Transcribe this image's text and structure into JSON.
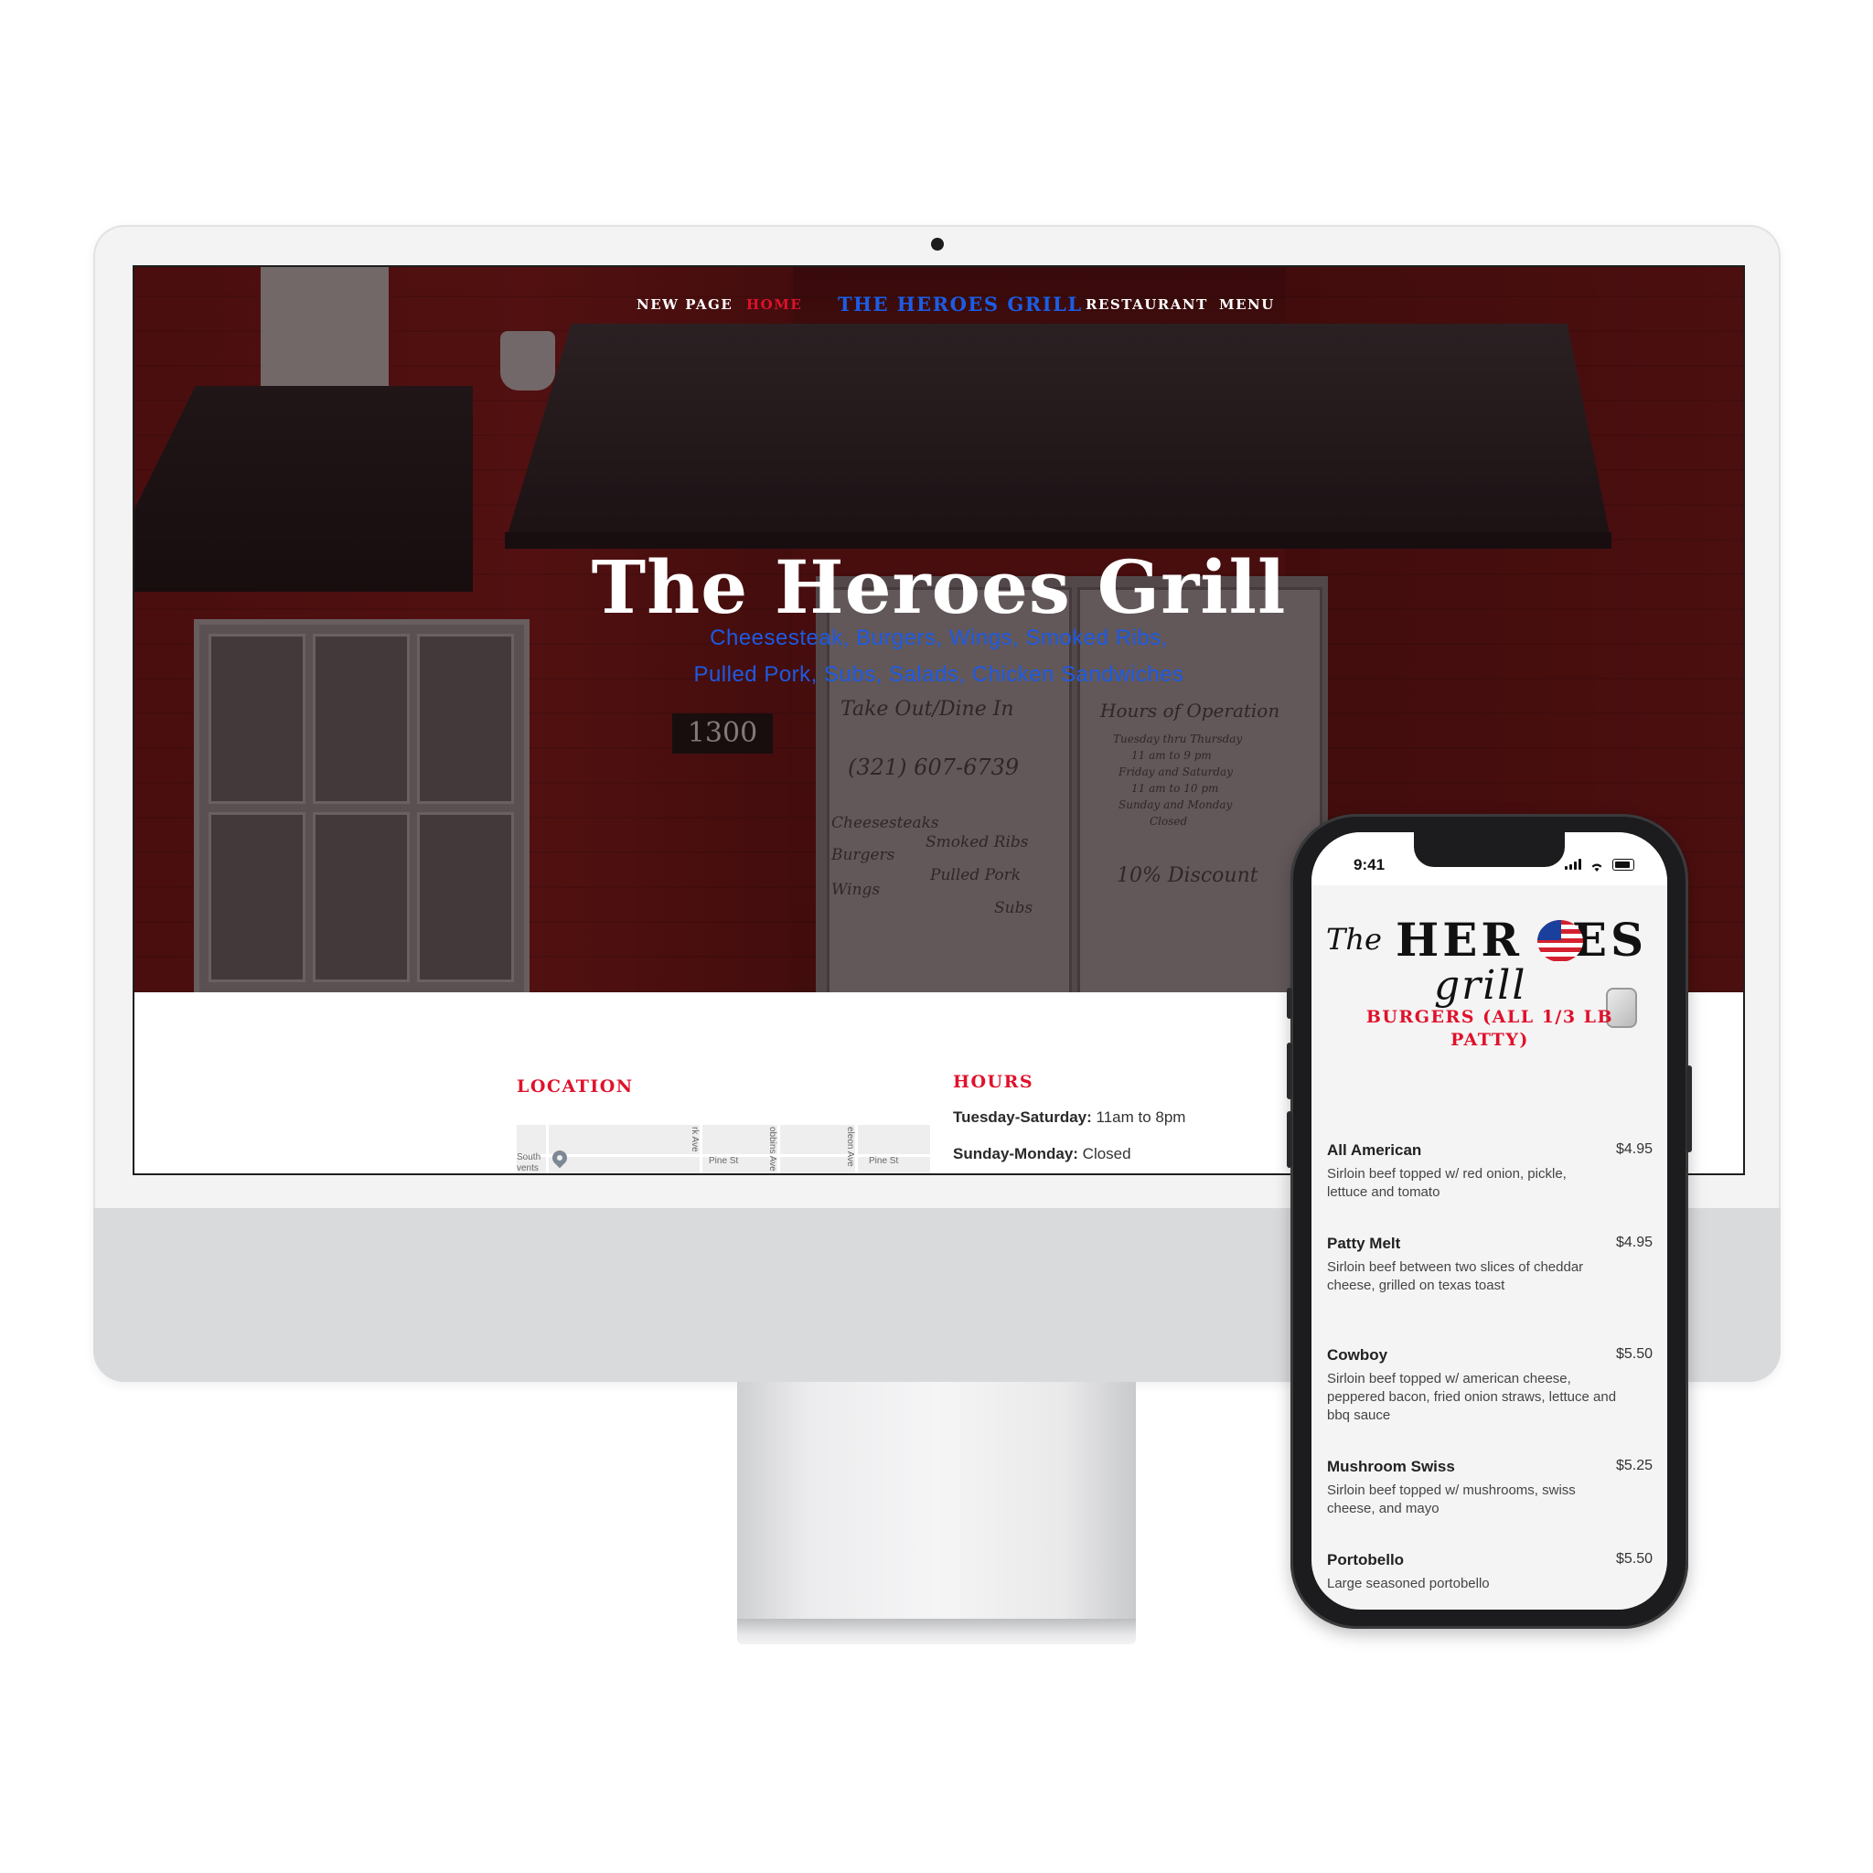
{
  "nav": {
    "items": [
      "NEW PAGE",
      "HOME",
      "RESTAURANT",
      "MENU"
    ],
    "brand": "THE HEROES GRILL",
    "active": "HOME"
  },
  "hero": {
    "title": "The Heroes Grill",
    "subtitle_line1": "Cheesesteak, Burgers, Wings, Smoked Ribs,",
    "subtitle_line2": "Pulled Pork, Subs, Salads, Chicken Sandwiches",
    "photo_text": {
      "address_number": "1300",
      "door_left": [
        "Take Out/Dine In",
        "(321) 607-6739",
        "Cheesesteaks",
        "Smoked Ribs",
        "Burgers",
        "Pulled Pork",
        "Wings",
        "Subs"
      ],
      "door_right": [
        "Hours of Operation",
        "Tuesday thru Thursday",
        "11 am to 9 pm",
        "Friday and Saturday",
        "11 am to 10 pm",
        "Sunday and Monday",
        "Closed",
        "10% Discount"
      ]
    }
  },
  "location": {
    "title": "LOCATION",
    "map_labels": [
      "Pine St",
      "Pine St",
      "rk Ave",
      "obbins Ave",
      "eleon Ave",
      "South",
      "vents"
    ]
  },
  "hours": {
    "title": "HOURS",
    "rows": [
      {
        "label": "Tuesday-Saturday:",
        "value": " 11am to 8pm"
      },
      {
        "label": "Sunday-Monday:",
        "value": " Closed"
      }
    ]
  },
  "phone": {
    "time": "9:41",
    "logo": {
      "the": "The",
      "heroes_a": "HER",
      "heroes_b": "ES",
      "grill": "grill"
    },
    "category": "BURGERS (ALL 1/3 LB PATTY)",
    "items": [
      {
        "name": "All American",
        "price": "$4.95",
        "desc": "Sirloin beef topped w/ red onion, pickle, lettuce and tomato"
      },
      {
        "name": "Patty Melt",
        "price": "$4.95",
        "desc": "Sirloin beef between two slices of cheddar cheese, grilled on texas toast"
      },
      {
        "name": "Cowboy",
        "price": "$5.50",
        "desc": "Sirloin beef topped w/ american cheese, peppered bacon, fried onion straws, lettuce and bbq sauce"
      },
      {
        "name": "Mushroom Swiss",
        "price": "$5.25",
        "desc": "Sirloin beef topped w/ mushrooms, swiss cheese, and mayo"
      },
      {
        "name": "Portobello",
        "price": "$5.50",
        "desc": "Large seasoned portobello"
      }
    ]
  },
  "colors": {
    "accent_red": "#e0112b",
    "accent_blue": "#1b5de6"
  }
}
